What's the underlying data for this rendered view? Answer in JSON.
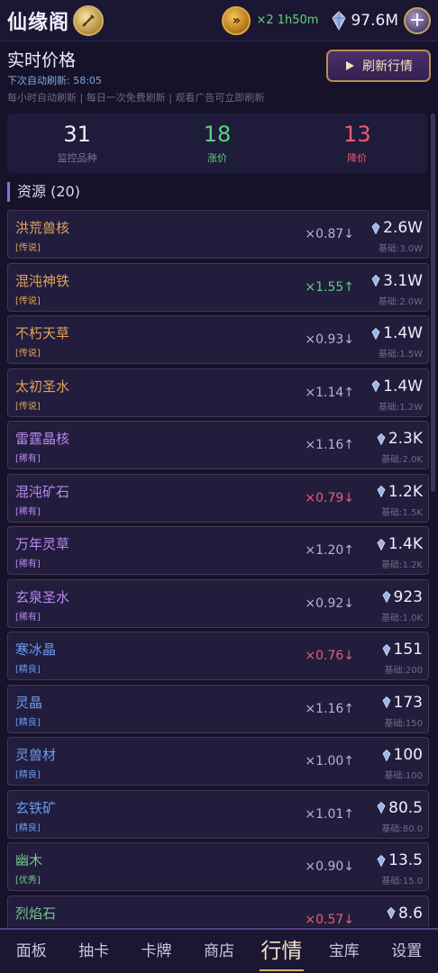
{
  "header": {
    "title": "仙缘阁",
    "boost": "×2 1h50m",
    "gems": "97.6M"
  },
  "price_header": {
    "title": "实时价格",
    "next_refresh": "下次自动刷新: 58:05",
    "note": "每小时自动刷新 | 每日一次免费刷新 | 观看广告可立即刷新",
    "refresh_label": "刷新行情"
  },
  "stats": [
    {
      "value": "31",
      "label": "监控品种"
    },
    {
      "value": "18",
      "label": "涨价"
    },
    {
      "value": "13",
      "label": "降价"
    }
  ],
  "section": {
    "title": "资源 (20)"
  },
  "items": [
    {
      "name": "洪荒兽核",
      "tier": "[传说]",
      "tier_class": "legend",
      "mult": "×0.87↓",
      "trend": "neutral",
      "price": "2.6W",
      "base": "基础:3.0W"
    },
    {
      "name": "混沌神铁",
      "tier": "[传说]",
      "tier_class": "legend",
      "mult": "×1.55↑",
      "trend": "up",
      "price": "3.1W",
      "base": "基础:2.0W"
    },
    {
      "name": "不朽天草",
      "tier": "[传说]",
      "tier_class": "legend",
      "mult": "×0.93↓",
      "trend": "neutral",
      "price": "1.4W",
      "base": "基础:1.5W"
    },
    {
      "name": "太初圣水",
      "tier": "[传说]",
      "tier_class": "legend",
      "mult": "×1.14↑",
      "trend": "neutral",
      "price": "1.4W",
      "base": "基础:1.2W"
    },
    {
      "name": "雷霆晶核",
      "tier": "[稀有]",
      "tier_class": "rare",
      "mult": "×1.16↑",
      "trend": "neutral",
      "price": "2.3K",
      "base": "基础:2.0K"
    },
    {
      "name": "混沌矿石",
      "tier": "[稀有]",
      "tier_class": "rare",
      "mult": "×0.79↓",
      "trend": "down",
      "price": "1.2K",
      "base": "基础:1.5K"
    },
    {
      "name": "万年灵草",
      "tier": "[稀有]",
      "tier_class": "rare",
      "mult": "×1.20↑",
      "trend": "neutral",
      "price": "1.4K",
      "base": "基础:1.2K"
    },
    {
      "name": "玄泉圣水",
      "tier": "[稀有]",
      "tier_class": "rare",
      "mult": "×0.92↓",
      "trend": "neutral",
      "price": "923",
      "base": "基础:1.0K"
    },
    {
      "name": "寒冰晶",
      "tier": "[精良]",
      "tier_class": "fine",
      "mult": "×0.76↓",
      "trend": "down",
      "price": "151",
      "base": "基础:200"
    },
    {
      "name": "灵晶",
      "tier": "[精良]",
      "tier_class": "fine",
      "mult": "×1.16↑",
      "trend": "neutral",
      "price": "173",
      "base": "基础:150"
    },
    {
      "name": "灵兽材",
      "tier": "[精良]",
      "tier_class": "fine",
      "mult": "×1.00↑",
      "trend": "neutral",
      "price": "100",
      "base": "基础:100"
    },
    {
      "name": "玄铁矿",
      "tier": "[精良]",
      "tier_class": "fine",
      "mult": "×1.01↑",
      "trend": "neutral",
      "price": "80.5",
      "base": "基础:80.0"
    },
    {
      "name": "幽木",
      "tier": "[优秀]",
      "tier_class": "good",
      "mult": "×0.90↓",
      "trend": "neutral",
      "price": "13.5",
      "base": "基础:15.0"
    },
    {
      "name": "烈焰石",
      "tier": "",
      "tier_class": "good",
      "mult": "×0.57↓",
      "trend": "down",
      "price": "8.6",
      "base": ""
    }
  ],
  "nav": [
    {
      "label": "面板",
      "active": false
    },
    {
      "label": "抽卡",
      "active": false
    },
    {
      "label": "卡牌",
      "active": false
    },
    {
      "label": "商店",
      "active": false
    },
    {
      "label": "行情",
      "active": true
    },
    {
      "label": "宝库",
      "active": false
    },
    {
      "label": "设置",
      "active": false
    }
  ]
}
